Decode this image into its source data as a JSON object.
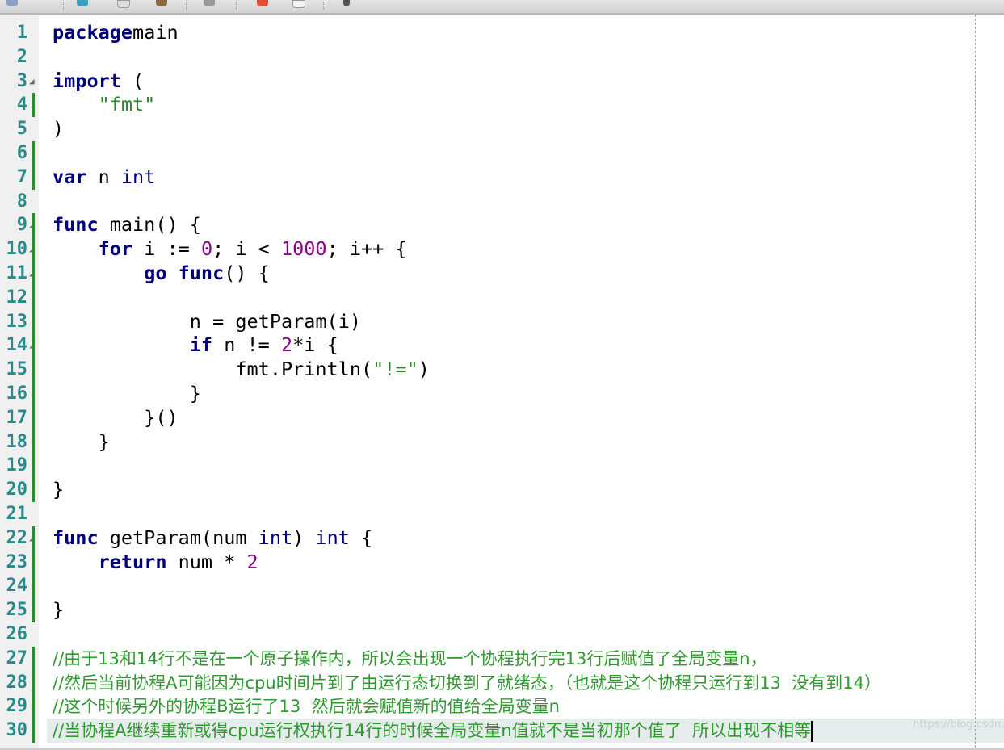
{
  "toolbar": {
    "icons": [
      "nav-back-icon",
      "run-icon",
      "new-file-icon",
      "open-folder-icon",
      "save-icon",
      "debug-icon",
      "bookmark-icon",
      "tools-icon"
    ]
  },
  "editor": {
    "colors": {
      "keyword": "#00007f",
      "string": "#2a8a2a",
      "number": "#8b008b",
      "comment": "#2f9a2f",
      "line_number": "#2a8a8a"
    },
    "current_line": 30,
    "watermark": "https://blog.csdn.n",
    "lines": [
      {
        "n": "1",
        "fold": false,
        "bar": false,
        "t": [
          [
            "kw",
            "package"
          ],
          [
            "",
            "main"
          ]
        ]
      },
      {
        "n": "2",
        "fold": false,
        "bar": false,
        "t": []
      },
      {
        "n": "3",
        "fold": true,
        "bar": false,
        "t": [
          [
            "kw",
            "import"
          ],
          [
            "",
            " ("
          ]
        ]
      },
      {
        "n": "4",
        "fold": false,
        "bar": true,
        "t": [
          [
            "",
            "    "
          ],
          [
            "str",
            "\"fmt\""
          ]
        ]
      },
      {
        "n": "5",
        "fold": false,
        "bar": false,
        "t": [
          [
            "",
            ")"
          ]
        ]
      },
      {
        "n": "6",
        "fold": false,
        "bar": true,
        "t": []
      },
      {
        "n": "7",
        "fold": false,
        "bar": true,
        "t": [
          [
            "kw",
            "var"
          ],
          [
            "",
            " n "
          ],
          [
            "ty",
            "int"
          ]
        ]
      },
      {
        "n": "8",
        "fold": false,
        "bar": false,
        "t": []
      },
      {
        "n": "9",
        "fold": true,
        "bar": true,
        "t": [
          [
            "kw",
            "func"
          ],
          [
            "",
            " main() {"
          ]
        ]
      },
      {
        "n": "10",
        "fold": true,
        "bar": true,
        "t": [
          [
            "",
            "    "
          ],
          [
            "kw",
            "for"
          ],
          [
            "",
            " i := "
          ],
          [
            "num",
            "0"
          ],
          [
            "",
            "; i < "
          ],
          [
            "num",
            "1000"
          ],
          [
            "",
            "; i++ {"
          ]
        ]
      },
      {
        "n": "11",
        "fold": true,
        "bar": true,
        "t": [
          [
            "",
            "        "
          ],
          [
            "kw",
            "go"
          ],
          [
            "",
            " "
          ],
          [
            "kw",
            "func"
          ],
          [
            "",
            "() {"
          ]
        ]
      },
      {
        "n": "12",
        "fold": false,
        "bar": true,
        "t": []
      },
      {
        "n": "13",
        "fold": false,
        "bar": true,
        "t": [
          [
            "",
            "            n = getParam(i)"
          ]
        ]
      },
      {
        "n": "14",
        "fold": true,
        "bar": true,
        "t": [
          [
            "",
            "            "
          ],
          [
            "kw",
            "if"
          ],
          [
            "",
            " n != "
          ],
          [
            "num",
            "2"
          ],
          [
            "",
            "*i {"
          ]
        ]
      },
      {
        "n": "15",
        "fold": false,
        "bar": true,
        "t": [
          [
            "",
            "                fmt.Println("
          ],
          [
            "str",
            "\"!=\""
          ],
          [
            "",
            ")"
          ]
        ]
      },
      {
        "n": "16",
        "fold": false,
        "bar": true,
        "t": [
          [
            "",
            "            }"
          ]
        ]
      },
      {
        "n": "17",
        "fold": false,
        "bar": true,
        "t": [
          [
            "",
            "        }()"
          ]
        ]
      },
      {
        "n": "18",
        "fold": false,
        "bar": true,
        "t": [
          [
            "",
            "    }"
          ]
        ]
      },
      {
        "n": "19",
        "fold": false,
        "bar": true,
        "t": []
      },
      {
        "n": "20",
        "fold": false,
        "bar": true,
        "t": [
          [
            "",
            "}"
          ]
        ]
      },
      {
        "n": "21",
        "fold": false,
        "bar": false,
        "t": []
      },
      {
        "n": "22",
        "fold": true,
        "bar": true,
        "t": [
          [
            "kw",
            "func"
          ],
          [
            "",
            " getParam(num "
          ],
          [
            "ty",
            "int"
          ],
          [
            "",
            ") "
          ],
          [
            "ty",
            "int"
          ],
          [
            "",
            " {"
          ]
        ]
      },
      {
        "n": "23",
        "fold": false,
        "bar": true,
        "t": [
          [
            "",
            "    "
          ],
          [
            "kw",
            "return"
          ],
          [
            "",
            " num * "
          ],
          [
            "num",
            "2"
          ]
        ]
      },
      {
        "n": "24",
        "fold": false,
        "bar": true,
        "t": []
      },
      {
        "n": "25",
        "fold": false,
        "bar": true,
        "t": [
          [
            "",
            "}"
          ]
        ]
      },
      {
        "n": "26",
        "fold": false,
        "bar": false,
        "t": []
      },
      {
        "n": "27",
        "fold": false,
        "bar": true,
        "t": [
          [
            "cm",
            "//由于13和14行不是在一个原子操作内，所以会出现一个协程执行完13行后赋值了全局变量n，"
          ]
        ]
      },
      {
        "n": "28",
        "fold": false,
        "bar": true,
        "t": [
          [
            "cm",
            "//然后当前协程A可能因为cpu时间片到了由运行态切换到了就绪态，（也就是这个协程只运行到13  没有到14）"
          ]
        ]
      },
      {
        "n": "29",
        "fold": false,
        "bar": true,
        "t": [
          [
            "cm",
            "//这个时候另外的协程B运行了13  然后就会赋值新的值给全局变量n"
          ]
        ]
      },
      {
        "n": "30",
        "fold": false,
        "bar": true,
        "t": [
          [
            "cm",
            "//当协程A继续重新或得cpu运行权执行14行的时候全局变量n值就不是当初那个值了  所以出现不相等"
          ]
        ]
      }
    ]
  }
}
